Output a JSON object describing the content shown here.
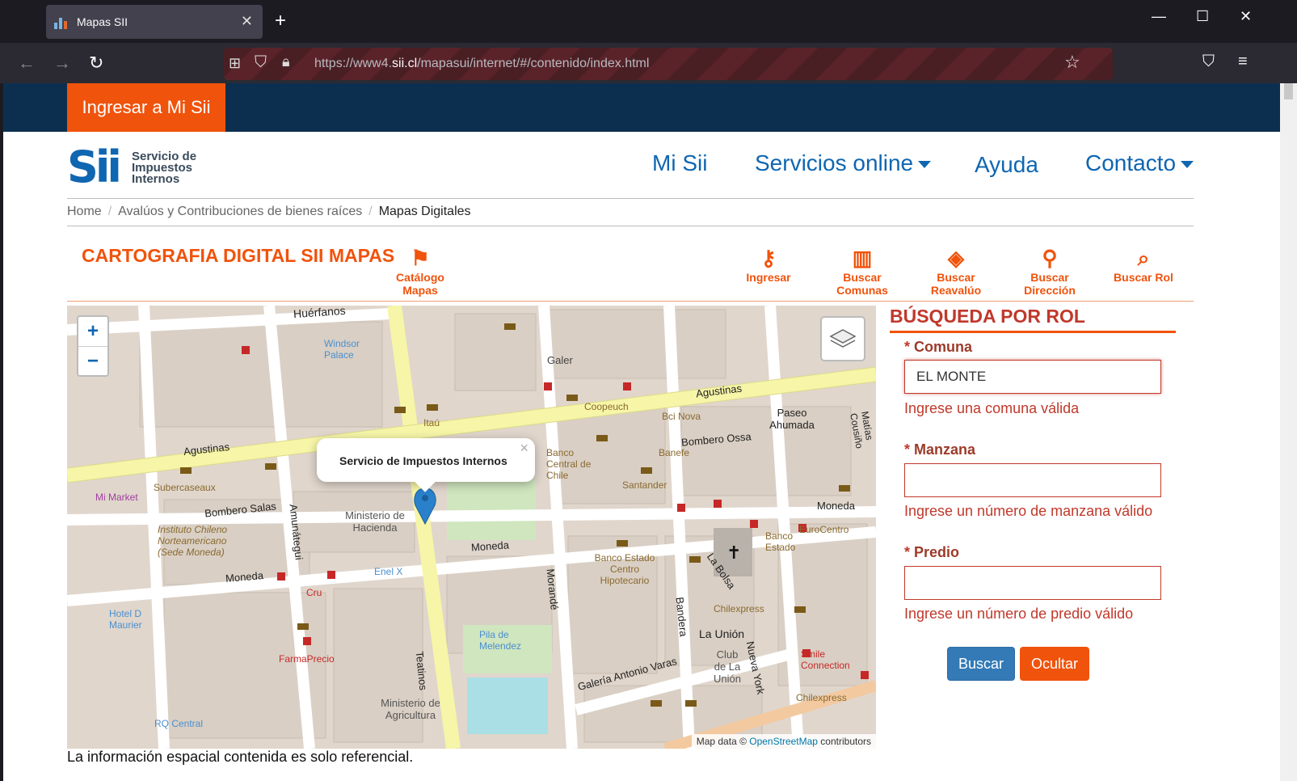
{
  "browser": {
    "tab_title": "Mapas SII",
    "url_prefix": "https://www4.",
    "url_domain": "sii.cl",
    "url_path": "/mapasui/internet/#/contenido/index.html"
  },
  "topstrip": {
    "ingresar_label": "Ingresar a Mi Sii"
  },
  "logo": {
    "mark": "Sii",
    "line1": "Servicio de",
    "line2": "Impuestos",
    "line3": "Internos"
  },
  "nav": {
    "mi_sii": "Mi Sii",
    "servicios": "Servicios online",
    "ayuda": "Ayuda",
    "contacto": "Contacto"
  },
  "breadcrumb": {
    "home": "Home",
    "avaluos": "Avalúos y Contribuciones de bienes raíces",
    "current": "Mapas Digitales"
  },
  "cartografia": {
    "title": "CARTOGRAFIA DIGITAL SII MAPAS",
    "catalogo_l1": "Catálogo",
    "catalogo_l2": "Mapas",
    "ingresar": "Ingresar",
    "buscar_comunas_l1": "Buscar",
    "buscar_comunas_l2": "Comunas",
    "buscar_reavaluo_l1": "Buscar",
    "buscar_reavaluo_l2": "Reavalúo",
    "buscar_direccion_l1": "Buscar",
    "buscar_direccion_l2": "Dirección",
    "buscar_rol": "Buscar Rol"
  },
  "map": {
    "zoom_in": "+",
    "zoom_out": "−",
    "popup_text": "Servicio de Impuestos Internos",
    "popup_close": "×",
    "attribution_prefix": "Map data © ",
    "attribution_link": "OpenStreetMap",
    "attribution_suffix": " contributors",
    "labels": {
      "agustinas": "Agustinas",
      "moneda": "Moneda",
      "teatinos": "Teatinos",
      "morande": "Morandé",
      "bandera": "Bandera",
      "huerfanos": "Huérfanos",
      "ministerio_hacienda": "Ministerio de Hacienda",
      "bombero_ossa": "Bombero Ossa",
      "bombero_salas": "Bombero Salas",
      "amunategui": "Amunátegui",
      "la_bolsa": "La Bolsa",
      "la_union": "La Unión",
      "nueva_york": "Nueva York",
      "galeria_antonio_varas": "Galería Antonio Varas",
      "banco_central": "Banco Central de Chile",
      "santander": "Santander",
      "eurocentro": "EuroCentro",
      "paseo_ahumada": "Paseo Ahumada",
      "pila_melendez": "Pila de Melendez",
      "ministerio_agricultura": "Ministerio de Agricultura",
      "farmaprecio": "FarmaPrecio",
      "subercaseaux": "Subercaseaux",
      "windsor": "Windsor Palace",
      "mi_market": "Mi Market",
      "chilexpress": "Chilexpress",
      "bci_nova": "Bci Nova",
      "coopeuch": "Coopeuch",
      "banco_estado": "Banco Estado",
      "banco_estado_centro": "Banco Estado Centro Hipotecario",
      "instituto": "Instituto Chileno Norteamericano (Sede Moneda)",
      "smile": "Smile Connection",
      "itau": "Itaú",
      "banefe": "Banefe",
      "enel": "Enel X",
      "cruz": "Cru",
      "rq_central": "RQ Central",
      "galeria": "Galer",
      "hotel": "Hotel D Maurier",
      "matias": "Matías Cousiño",
      "club_union": "Club de La Unión"
    }
  },
  "busqueda": {
    "title": "BÚSQUEDA POR ROL",
    "asterisk": "*",
    "comuna_label": "Comuna",
    "comuna_value": "EL MONTE",
    "comuna_error": "Ingrese una comuna válida",
    "manzana_label": "Manzana",
    "manzana_value": "",
    "manzana_error": "Ingrese un número de manzana válido",
    "predio_label": "Predio",
    "predio_value": "",
    "predio_error": "Ingrese un número de predio válido",
    "buscar_btn": "Buscar",
    "ocultar_btn": "Ocultar"
  },
  "note": "La información espacial contenida es solo referencial.",
  "colors": {
    "orange": "#f0530c",
    "navy": "#0c2f4f",
    "blue": "#0f66b1",
    "error": "#c0392b",
    "buscar": "#337ab7"
  }
}
